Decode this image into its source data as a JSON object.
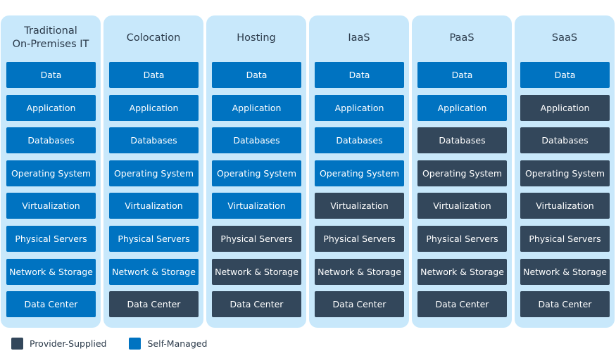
{
  "colors": {
    "self_managed": "#0073c1",
    "provider_supplied": "#33475b",
    "column_bg": "#c8e8fb"
  },
  "columns": [
    {
      "title": "Traditional\nOn-Premises IT",
      "layers": [
        {
          "label": "Data",
          "type": "self"
        },
        {
          "label": "Application",
          "type": "self"
        },
        {
          "label": "Databases",
          "type": "self"
        },
        {
          "label": "Operating System",
          "type": "self"
        },
        {
          "label": "Virtualization",
          "type": "self"
        },
        {
          "label": "Physical Servers",
          "type": "self"
        },
        {
          "label": "Network & Storage",
          "type": "self"
        },
        {
          "label": "Data Center",
          "type": "self"
        }
      ]
    },
    {
      "title": "Colocation",
      "layers": [
        {
          "label": "Data",
          "type": "self"
        },
        {
          "label": "Application",
          "type": "self"
        },
        {
          "label": "Databases",
          "type": "self"
        },
        {
          "label": "Operating System",
          "type": "self"
        },
        {
          "label": "Virtualization",
          "type": "self"
        },
        {
          "label": "Physical Servers",
          "type": "self"
        },
        {
          "label": "Network & Storage",
          "type": "self"
        },
        {
          "label": "Data Center",
          "type": "provider"
        }
      ]
    },
    {
      "title": "Hosting",
      "layers": [
        {
          "label": "Data",
          "type": "self"
        },
        {
          "label": "Application",
          "type": "self"
        },
        {
          "label": "Databases",
          "type": "self"
        },
        {
          "label": "Operating System",
          "type": "self"
        },
        {
          "label": "Virtualization",
          "type": "self"
        },
        {
          "label": "Physical Servers",
          "type": "provider"
        },
        {
          "label": "Network & Storage",
          "type": "provider"
        },
        {
          "label": "Data Center",
          "type": "provider"
        }
      ]
    },
    {
      "title": "IaaS",
      "layers": [
        {
          "label": "Data",
          "type": "self"
        },
        {
          "label": "Application",
          "type": "self"
        },
        {
          "label": "Databases",
          "type": "self"
        },
        {
          "label": "Operating System",
          "type": "self"
        },
        {
          "label": "Virtualization",
          "type": "provider"
        },
        {
          "label": "Physical Servers",
          "type": "provider"
        },
        {
          "label": "Network & Storage",
          "type": "provider"
        },
        {
          "label": "Data Center",
          "type": "provider"
        }
      ]
    },
    {
      "title": "PaaS",
      "layers": [
        {
          "label": "Data",
          "type": "self"
        },
        {
          "label": "Application",
          "type": "self"
        },
        {
          "label": "Databases",
          "type": "provider"
        },
        {
          "label": "Operating System",
          "type": "provider"
        },
        {
          "label": "Virtualization",
          "type": "provider"
        },
        {
          "label": "Physical Servers",
          "type": "provider"
        },
        {
          "label": "Network & Storage",
          "type": "provider"
        },
        {
          "label": "Data Center",
          "type": "provider"
        }
      ]
    },
    {
      "title": "SaaS",
      "layers": [
        {
          "label": "Data",
          "type": "self"
        },
        {
          "label": "Application",
          "type": "provider"
        },
        {
          "label": "Databases",
          "type": "provider"
        },
        {
          "label": "Operating System",
          "type": "provider"
        },
        {
          "label": "Virtualization",
          "type": "provider"
        },
        {
          "label": "Physical Servers",
          "type": "provider"
        },
        {
          "label": "Network & Storage",
          "type": "provider"
        },
        {
          "label": "Data Center",
          "type": "provider"
        }
      ]
    }
  ],
  "legend": [
    {
      "label": "Provider-Supplied",
      "type": "provider"
    },
    {
      "label": "Self-Managed",
      "type": "self"
    }
  ]
}
